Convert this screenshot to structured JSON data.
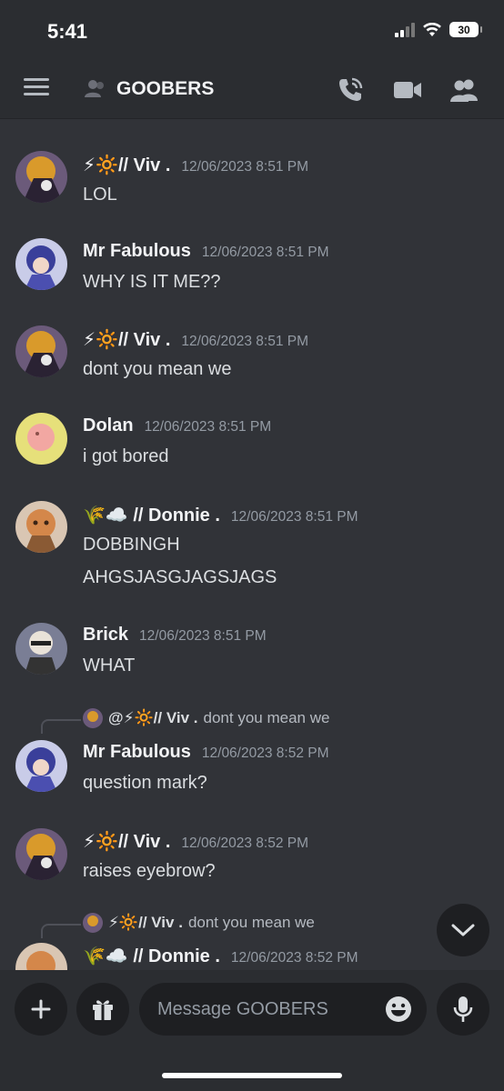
{
  "status_bar": {
    "time": "5:41",
    "battery": "30"
  },
  "header": {
    "channel_name": "GOOBERS"
  },
  "messages": [
    {
      "author": "⚡🔆// Viv .",
      "timestamp": "12/06/2023 8:51 PM",
      "lines": [
        "LOL"
      ]
    },
    {
      "author": "Mr Fabulous",
      "timestamp": "12/06/2023 8:51 PM",
      "lines": [
        "WHY IS IT ME??"
      ]
    },
    {
      "author": "⚡🔆// Viv .",
      "timestamp": "12/06/2023 8:51 PM",
      "lines": [
        "dont you mean we"
      ]
    },
    {
      "author": "Dolan",
      "timestamp": "12/06/2023 8:51 PM",
      "lines": [
        "i got bored"
      ]
    },
    {
      "author": "🌾☁️ // Donnie .",
      "timestamp": "12/06/2023 8:51 PM",
      "lines": [
        "DOBBINGH",
        "AHGSJASGJAGSJAGS"
      ]
    },
    {
      "author": "Brick",
      "timestamp": "12/06/2023 8:51 PM",
      "lines": [
        "WHAT"
      ]
    },
    {
      "reply_author": "@⚡🔆// Viv .",
      "reply_text": "dont you mean we",
      "author": "Mr Fabulous",
      "timestamp": "12/06/2023 8:52 PM",
      "lines": [
        "question mark?"
      ]
    },
    {
      "author": "⚡🔆// Viv .",
      "timestamp": "12/06/2023 8:52 PM",
      "lines": [
        "raises eyebrow?"
      ]
    },
    {
      "reply_author": "⚡🔆// Viv .",
      "reply_text": "dont you mean we",
      "author": "🌾☁️ // Donnie .",
      "timestamp": "12/06/2023 8:52 PM",
      "lines": []
    }
  ],
  "composer": {
    "placeholder": "Message GOOBERS"
  },
  "colors": {
    "background": "#313338",
    "header": "#2b2d31",
    "input": "#1e1f22",
    "timestamp": "#949ba4"
  }
}
